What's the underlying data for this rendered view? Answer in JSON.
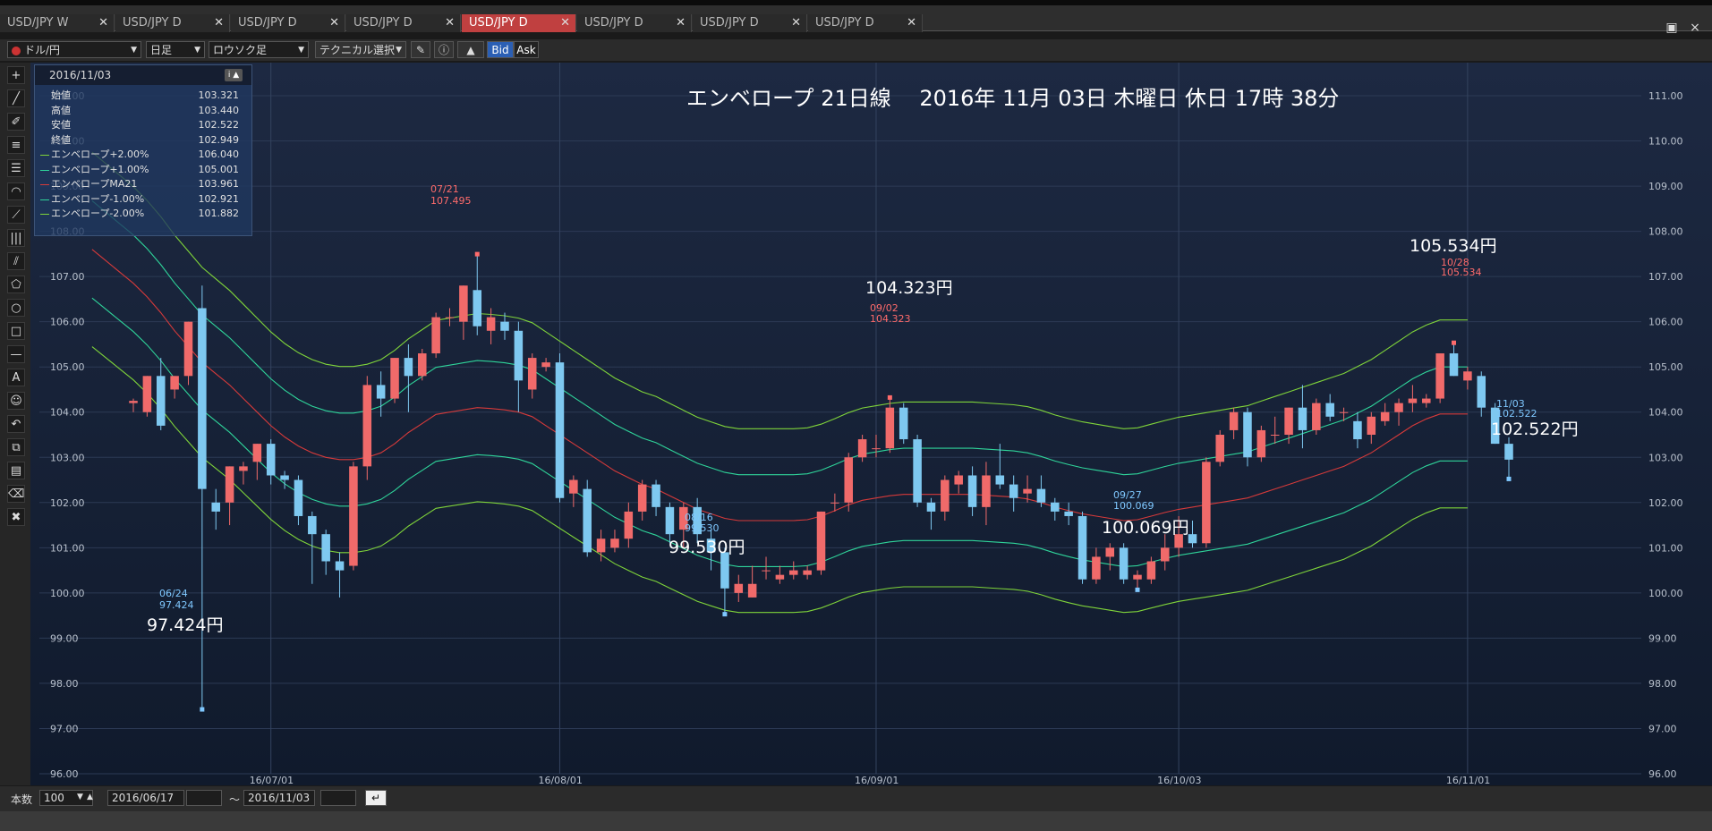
{
  "tabs": [
    {
      "label": "USD/JPY W",
      "active": false
    },
    {
      "label": "USD/JPY D",
      "active": false
    },
    {
      "label": "USD/JPY D",
      "active": false
    },
    {
      "label": "USD/JPY D",
      "active": false
    },
    {
      "label": "USD/JPY D",
      "active": true
    },
    {
      "label": "USD/JPY D",
      "active": false
    },
    {
      "label": "USD/JPY D",
      "active": false
    },
    {
      "label": "USD/JPY D",
      "active": false
    }
  ],
  "toolbar": {
    "pair": "ドル/円",
    "period": "日足",
    "chart_type": "ロウソク足",
    "tech_select": "テクニカル選択",
    "bid": "Bid",
    "ask": "Ask",
    "close_icon": "×"
  },
  "info": {
    "date": "2016/11/03",
    "rows": [
      {
        "label": "始値",
        "value": "103.321",
        "color": ""
      },
      {
        "label": "高値",
        "value": "103.440",
        "color": ""
      },
      {
        "label": "安値",
        "value": "102.522",
        "color": ""
      },
      {
        "label": "終値",
        "value": "102.949",
        "color": ""
      },
      {
        "label": "エンベロープ+2.00%",
        "value": "106.040",
        "color": "#7fd43a"
      },
      {
        "label": "エンベロープ+1.00%",
        "value": "105.001",
        "color": "#2fd49a"
      },
      {
        "label": "エンベロープMA21",
        "value": "103.961",
        "color": "#d63a3a"
      },
      {
        "label": "エンベロープ-1.00%",
        "value": "102.921",
        "color": "#2fd49a"
      },
      {
        "label": "エンベロープ-2.00%",
        "value": "101.882",
        "color": "#7fd43a"
      }
    ]
  },
  "chart_title": "エンベロープ 21日線　 2016年 11月 03日 木曜日 休日 17時 38分",
  "chart_data": {
    "type": "candlestick",
    "ylim": [
      96.0,
      111.0
    ],
    "yticks": [
      "96.00",
      "97.00",
      "98.00",
      "99.00",
      "100.00",
      "101.00",
      "102.00",
      "103.00",
      "104.00",
      "105.00",
      "106.00",
      "107.00",
      "108.00",
      "109.00",
      "110.00",
      "111.00"
    ],
    "xticks": [
      {
        "label": "16/07/01",
        "index": 10
      },
      {
        "label": "16/08/01",
        "index": 31
      },
      {
        "label": "16/09/01",
        "index": 54
      },
      {
        "label": "16/10/03",
        "index": 76
      },
      {
        "label": "16/11/01",
        "index": 97
      }
    ],
    "candles": [
      [
        104.2,
        104.3,
        104.0,
        104.25
      ],
      [
        104.0,
        104.8,
        103.9,
        104.8
      ],
      [
        104.8,
        105.2,
        103.6,
        103.7
      ],
      [
        104.5,
        104.8,
        104.3,
        104.8
      ],
      [
        104.8,
        106.0,
        104.6,
        106.0
      ],
      [
        106.3,
        106.8,
        97.424,
        102.3
      ],
      [
        102.0,
        102.3,
        101.4,
        101.8
      ],
      [
        102.0,
        102.8,
        101.5,
        102.8
      ],
      [
        102.7,
        102.9,
        102.4,
        102.8
      ],
      [
        102.9,
        103.3,
        102.5,
        103.3
      ],
      [
        103.3,
        103.4,
        102.4,
        102.6
      ],
      [
        102.6,
        102.7,
        102.3,
        102.5
      ],
      [
        102.5,
        102.6,
        101.5,
        101.7
      ],
      [
        101.7,
        101.8,
        100.2,
        101.3
      ],
      [
        101.3,
        101.4,
        100.4,
        100.7
      ],
      [
        100.7,
        100.9,
        99.9,
        100.5
      ],
      [
        100.6,
        102.9,
        100.5,
        102.8
      ],
      [
        102.8,
        104.8,
        102.5,
        104.6
      ],
      [
        104.6,
        104.9,
        103.9,
        104.3
      ],
      [
        104.3,
        105.2,
        104.2,
        105.2
      ],
      [
        105.2,
        105.5,
        104.0,
        104.8
      ],
      [
        104.8,
        105.4,
        104.7,
        105.3
      ],
      [
        105.3,
        106.2,
        105.2,
        106.1
      ],
      [
        106.1,
        106.3,
        105.9,
        106.1
      ],
      [
        106.0,
        106.8,
        105.6,
        106.8
      ],
      [
        106.7,
        107.495,
        105.7,
        105.9
      ],
      [
        105.8,
        106.3,
        105.5,
        106.1
      ],
      [
        106.0,
        106.2,
        105.6,
        105.8
      ],
      [
        105.8,
        106.0,
        104.0,
        104.7
      ],
      [
        104.5,
        105.3,
        104.3,
        105.2
      ],
      [
        105.0,
        105.2,
        104.9,
        105.1
      ],
      [
        105.1,
        105.3,
        102.0,
        102.1
      ],
      [
        102.2,
        102.6,
        101.9,
        102.5
      ],
      [
        102.3,
        102.5,
        100.8,
        100.9
      ],
      [
        100.9,
        101.4,
        100.7,
        101.2
      ],
      [
        101.0,
        101.4,
        100.9,
        101.2
      ],
      [
        101.2,
        102.0,
        101.0,
        101.8
      ],
      [
        101.8,
        102.5,
        101.6,
        102.4
      ],
      [
        102.4,
        102.5,
        101.7,
        101.9
      ],
      [
        101.9,
        102.0,
        101.1,
        101.3
      ],
      [
        101.4,
        102.0,
        101.0,
        101.9
      ],
      [
        101.9,
        102.1,
        101.1,
        101.3
      ],
      [
        101.2,
        101.4,
        100.5,
        100.9
      ],
      [
        100.9,
        101.0,
        99.53,
        100.1
      ],
      [
        100.0,
        100.4,
        99.8,
        100.2
      ],
      [
        99.9,
        100.6,
        99.9,
        100.2
      ],
      [
        100.5,
        100.8,
        100.3,
        100.5
      ],
      [
        100.3,
        100.6,
        100.2,
        100.4
      ],
      [
        100.4,
        100.7,
        100.3,
        100.5
      ],
      [
        100.4,
        100.6,
        100.3,
        100.5
      ],
      [
        100.5,
        101.8,
        100.4,
        101.8
      ],
      [
        102.0,
        102.2,
        101.8,
        102.0
      ],
      [
        102.0,
        103.1,
        101.8,
        103.0
      ],
      [
        103.0,
        103.5,
        102.9,
        103.4
      ],
      [
        103.2,
        103.5,
        103.0,
        103.2
      ],
      [
        103.2,
        104.323,
        103.1,
        104.1
      ],
      [
        104.1,
        104.2,
        103.3,
        103.4
      ],
      [
        103.4,
        103.5,
        101.9,
        102.0
      ],
      [
        102.0,
        102.1,
        101.4,
        101.8
      ],
      [
        101.8,
        102.6,
        101.6,
        102.5
      ],
      [
        102.4,
        102.7,
        102.2,
        102.6
      ],
      [
        102.6,
        102.8,
        101.7,
        101.9
      ],
      [
        101.9,
        102.9,
        101.5,
        102.6
      ],
      [
        102.6,
        103.3,
        102.3,
        102.4
      ],
      [
        102.4,
        102.6,
        101.8,
        102.1
      ],
      [
        102.2,
        102.6,
        102.0,
        102.3
      ],
      [
        102.3,
        102.6,
        101.9,
        102.0
      ],
      [
        102.0,
        102.1,
        101.6,
        101.8
      ],
      [
        101.8,
        102.0,
        101.5,
        101.7
      ],
      [
        101.7,
        101.8,
        100.2,
        100.3
      ],
      [
        100.3,
        101.0,
        100.2,
        100.8
      ],
      [
        100.8,
        101.1,
        100.5,
        101.0
      ],
      [
        101.0,
        101.1,
        100.2,
        100.3
      ],
      [
        100.3,
        100.5,
        100.069,
        100.4
      ],
      [
        100.3,
        100.8,
        100.2,
        100.7
      ],
      [
        100.7,
        101.3,
        100.5,
        101.0
      ],
      [
        101.0,
        101.7,
        100.8,
        101.3
      ],
      [
        101.3,
        101.6,
        101.0,
        101.1
      ],
      [
        101.1,
        103.0,
        101.0,
        102.9
      ],
      [
        102.9,
        103.6,
        102.8,
        103.5
      ],
      [
        103.6,
        104.1,
        103.4,
        104.0
      ],
      [
        104.0,
        104.1,
        102.8,
        103.0
      ],
      [
        103.0,
        103.7,
        102.9,
        103.6
      ],
      [
        103.5,
        103.9,
        103.3,
        103.5
      ],
      [
        103.5,
        104.1,
        103.3,
        104.1
      ],
      [
        104.1,
        104.6,
        103.2,
        103.6
      ],
      [
        103.6,
        104.3,
        103.5,
        104.2
      ],
      [
        104.2,
        104.4,
        103.8,
        103.9
      ],
      [
        104.0,
        104.1,
        103.8,
        104.0
      ],
      [
        103.8,
        104.0,
        103.2,
        103.4
      ],
      [
        103.5,
        104.0,
        103.3,
        103.9
      ],
      [
        103.8,
        104.2,
        103.7,
        104.0
      ],
      [
        104.0,
        104.3,
        103.7,
        104.2
      ],
      [
        104.2,
        104.6,
        104.0,
        104.3
      ],
      [
        104.2,
        104.4,
        104.1,
        104.3
      ],
      [
        104.3,
        105.3,
        104.2,
        105.3
      ],
      [
        105.3,
        105.534,
        104.8,
        104.8
      ],
      [
        104.7,
        105.0,
        104.5,
        104.9
      ],
      [
        104.8,
        104.9,
        103.9,
        104.1
      ],
      [
        104.1,
        104.2,
        103.3,
        103.3
      ],
      [
        103.3,
        103.44,
        102.522,
        102.949
      ]
    ],
    "envelope": {
      "ma21": [
        107.6,
        107.35,
        107.1,
        106.85,
        106.55,
        106.2,
        105.8,
        105.45,
        105.1,
        104.85,
        104.6,
        104.3,
        104.0,
        103.7,
        103.45,
        103.25,
        103.1,
        103.0,
        102.95,
        102.95,
        103.0,
        103.1,
        103.3,
        103.55,
        103.75,
        103.95,
        104.0,
        104.05,
        104.1,
        104.08,
        104.05,
        104.0,
        103.9,
        103.7,
        103.5,
        103.3,
        103.1,
        102.9,
        102.7,
        102.55,
        102.4,
        102.3,
        102.15,
        102.0,
        101.85,
        101.75,
        101.65,
        101.6,
        101.6,
        101.6,
        101.6,
        101.6,
        101.62,
        101.7,
        101.82,
        101.95,
        102.05,
        102.1,
        102.15,
        102.18,
        102.18,
        102.18,
        102.18,
        102.18,
        102.18,
        102.16,
        102.14,
        102.12,
        102.08,
        102.0,
        101.9,
        101.82,
        101.75,
        101.7,
        101.65,
        101.6,
        101.62,
        101.7,
        101.78,
        101.85,
        101.9,
        101.95,
        102.0,
        102.05,
        102.1,
        102.2,
        102.3,
        102.4,
        102.5,
        102.6,
        102.7,
        102.8,
        102.95,
        103.1,
        103.3,
        103.5,
        103.7,
        103.85,
        103.96,
        103.96,
        103.96
      ]
    }
  },
  "annotations": {
    "low1_small": "06/24",
    "low1_small_val": "97.424",
    "low1_big": "97.424円",
    "high1_small": "07/21",
    "high1_small_val": "107.495",
    "low2_small": "08/16",
    "low2_small_val": "99.530",
    "low2_big": "99.530円",
    "high2_small": "09/02",
    "high2_small_val": "104.323",
    "high2_big": "104.323円",
    "low3_small": "09/27",
    "low3_small_val": "100.069",
    "low3_big": "100.069円",
    "high3_small": "10/28",
    "high3_small_val": "105.534",
    "high3_big": "105.534円",
    "last_small": "11/03",
    "last_small_val": "102.522",
    "last_big": "102.522円"
  },
  "bottom": {
    "count_label": "本数",
    "count_value": "100",
    "start_date": "2016/06/17",
    "tilde": "〜",
    "end_date": "2016/11/03"
  }
}
